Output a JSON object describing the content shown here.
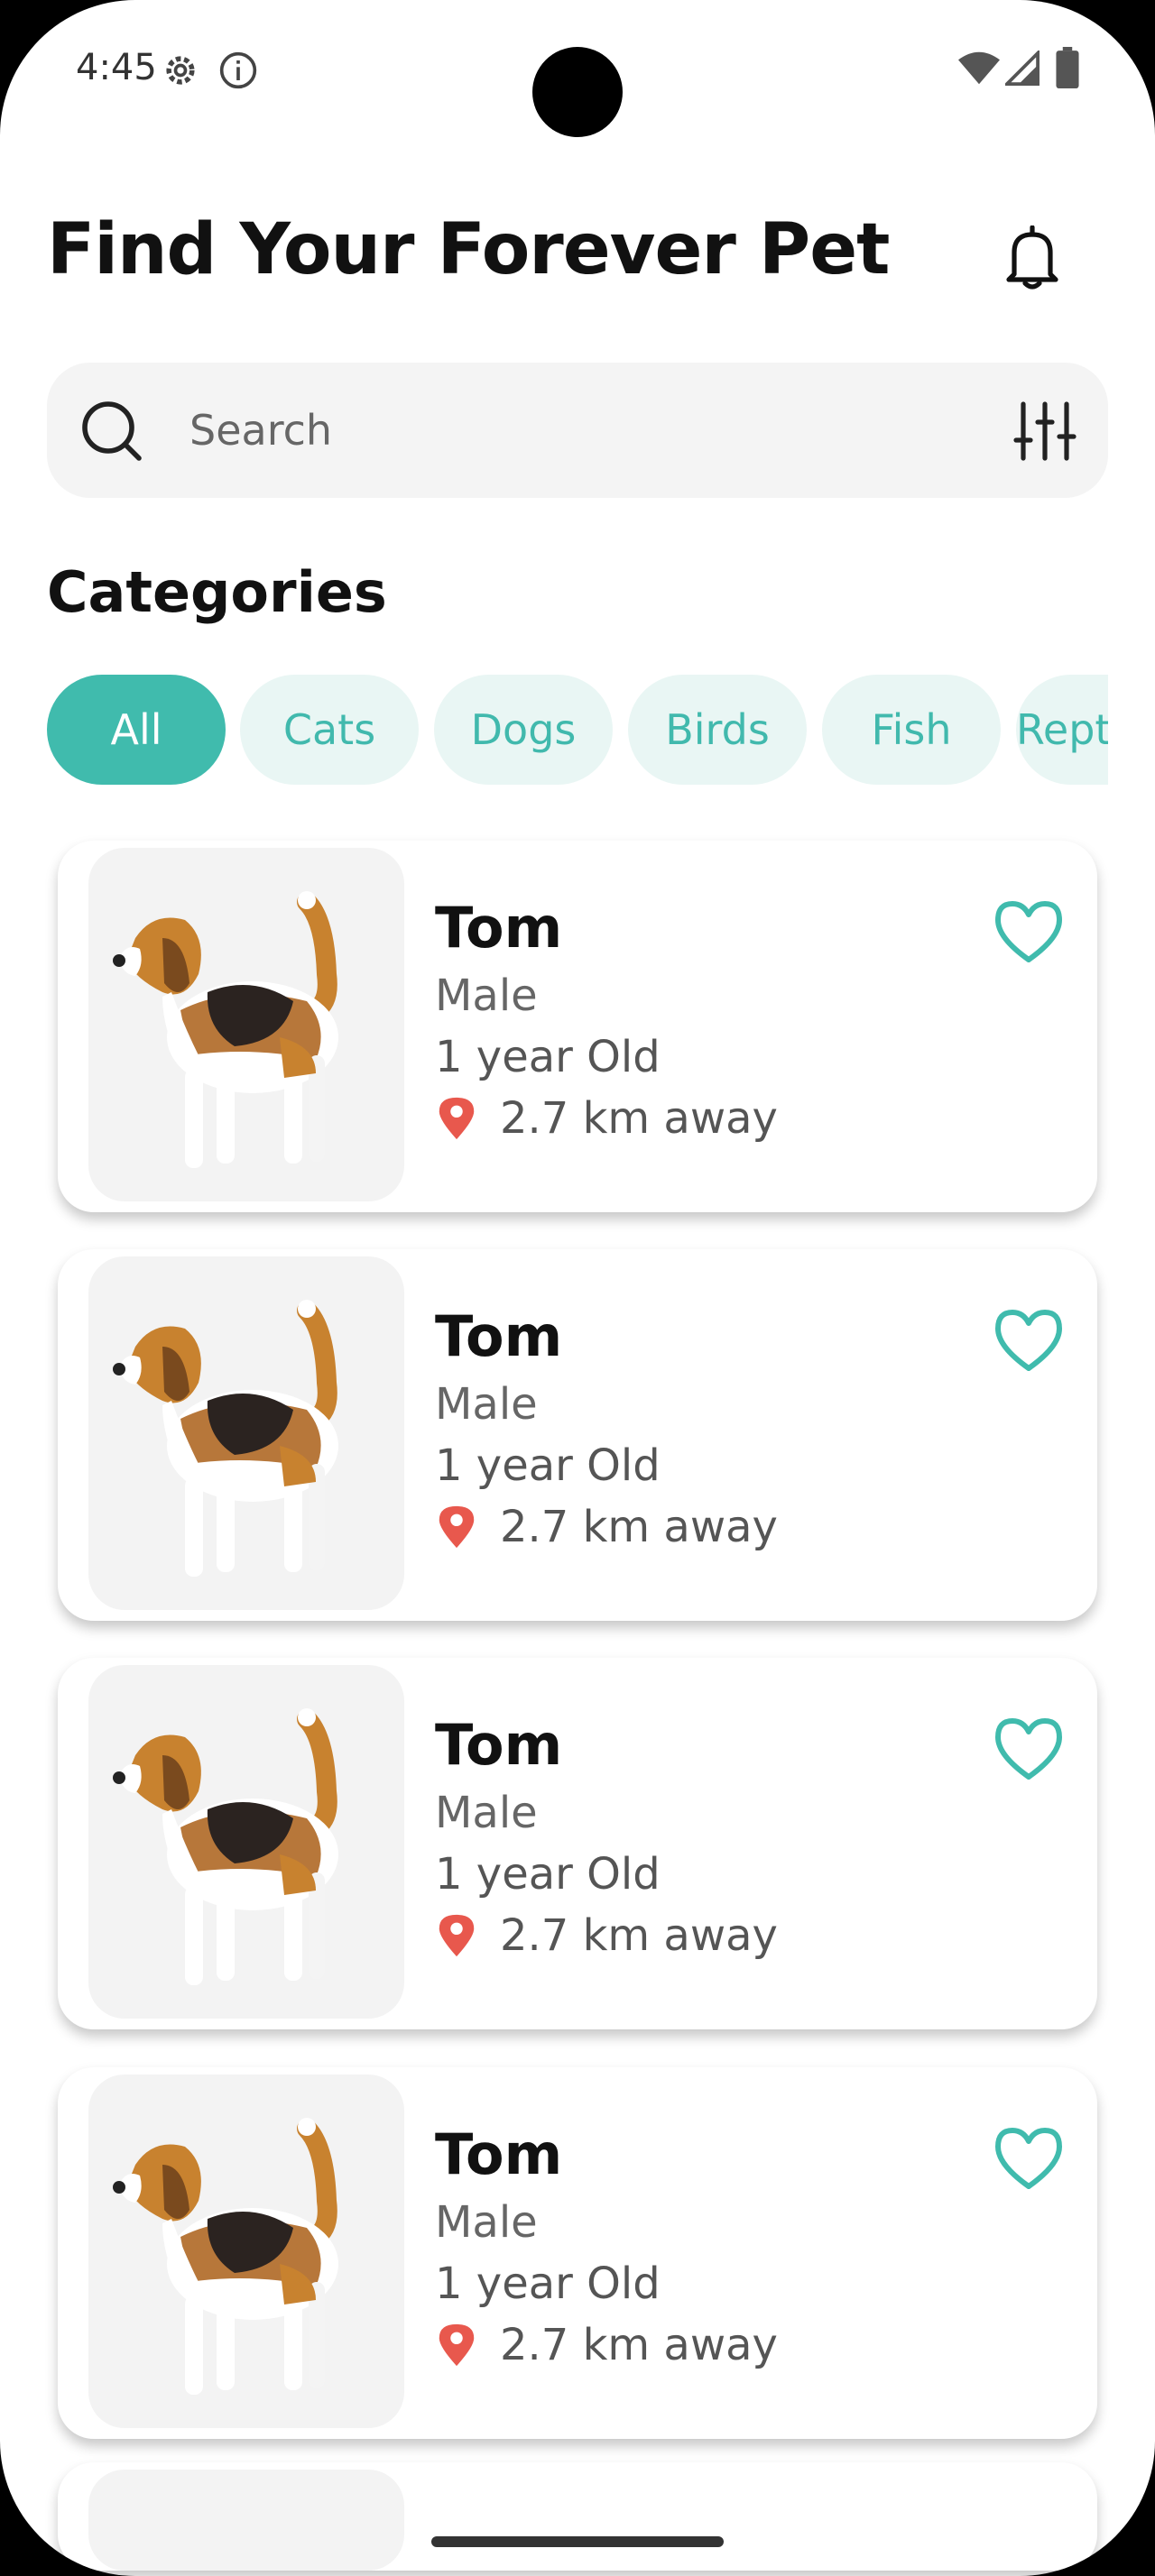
{
  "status_bar": {
    "time": "4:45"
  },
  "header": {
    "title": "Find Your Forever Pet"
  },
  "search": {
    "placeholder": "Search"
  },
  "categories": {
    "title": "Categories",
    "items": [
      "All",
      "Cats",
      "Dogs",
      "Birds",
      "Fish",
      "Reptiles"
    ],
    "selected": "All"
  },
  "pets": [
    {
      "name": "Tom",
      "gender": "Male",
      "age": "1 year Old",
      "distance": "2.7 km away"
    },
    {
      "name": "Tom",
      "gender": "Male",
      "age": "1 year Old",
      "distance": "2.7 km away"
    },
    {
      "name": "Tom",
      "gender": "Male",
      "age": "1 year Old",
      "distance": "2.7 km away"
    },
    {
      "name": "Tom",
      "gender": "Male",
      "age": "1 year Old",
      "distance": "2.7 km away"
    }
  ],
  "colors": {
    "accent": "#40bbad",
    "chip_bg": "#e9f6f4",
    "pin": "#e8584d"
  },
  "icons": [
    "settings-icon",
    "info-icon",
    "wifi-icon",
    "signal-icon",
    "battery-icon",
    "bell-icon",
    "search-icon",
    "filter-icon",
    "heart-icon",
    "location-pin-icon"
  ]
}
